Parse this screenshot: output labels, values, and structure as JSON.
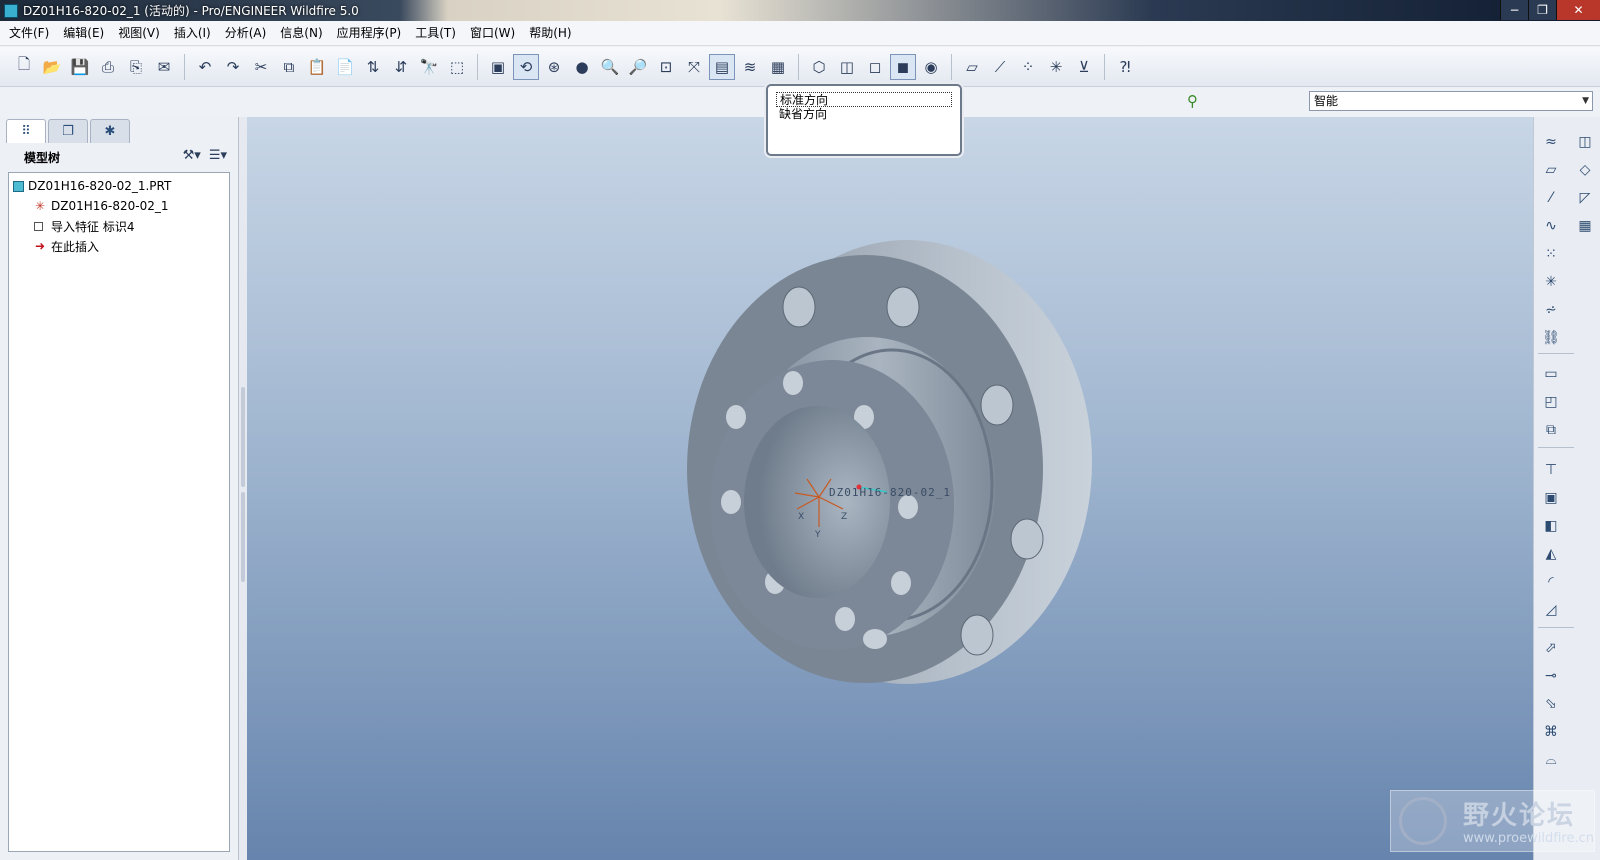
{
  "window": {
    "title": "DZ01H16-820-02_1 (活动的) - Pro/ENGINEER Wildfire 5.0",
    "buttons": [
      "−",
      "❐",
      "✕"
    ]
  },
  "menu": [
    "文件(F)",
    "编辑(E)",
    "视图(V)",
    "插入(I)",
    "分析(A)",
    "信息(N)",
    "应用程序(P)",
    "工具(T)",
    "窗口(W)",
    "帮助(H)"
  ],
  "toolbar": {
    "groups": [
      [
        "new-icon",
        "open-icon",
        "save-icon",
        "print-icon",
        "print-preview-icon",
        "email-icon"
      ],
      [
        "undo-icon",
        "redo-icon",
        "cut-icon",
        "copy-icon",
        "paste-icon",
        "paste-special-icon",
        "regenerate-icon",
        "regenerate-manager-icon",
        "find-icon",
        "select-box-icon"
      ],
      [
        "redraw-icon",
        "spin-center-icon",
        "orient-mode-icon",
        "appearance-icon",
        "zoom-in-icon",
        "zoom-out-icon",
        "refit-icon",
        "reorient-icon",
        "saved-views-icon",
        "layers-icon",
        "view-manager-icon"
      ],
      [
        "wireframe-icon",
        "hidden-line-icon",
        "no-hidden-icon",
        "shading-icon",
        "enhanced-realism-icon"
      ],
      [
        "datum-planes-icon",
        "datum-axes-icon",
        "datum-points-icon",
        "coord-systems-icon",
        "annotations-icon"
      ],
      [
        "context-help-icon"
      ]
    ],
    "pressed": [
      "orient-mode-icon",
      "saved-views-icon",
      "shading-icon"
    ]
  },
  "view_dropdown": {
    "options": [
      "标准方向",
      "缺省方向"
    ],
    "selected": "标准方向"
  },
  "filter": {
    "value": "智能"
  },
  "left_panel": {
    "tabs": [
      "model-tree-tab-icon",
      "folder-browser-tab-icon",
      "favorites-tab-icon"
    ],
    "header": "模型树",
    "tree": [
      {
        "label": "DZ01H16-820-02_1.PRT",
        "icon": "part-icon",
        "level": 0
      },
      {
        "label": "DZ01H16-820-02_1",
        "icon": "csys-icon",
        "level": 1
      },
      {
        "label": "导入特征 标识4",
        "icon": "import-feature-icon",
        "level": 1
      },
      {
        "label": "在此插入",
        "icon": "insert-here-icon",
        "level": 1
      }
    ]
  },
  "viewport": {
    "csys_label": "DZ01H16-820-02_1",
    "axis_labels": [
      "X",
      "Y",
      "Z"
    ]
  },
  "watermark": {
    "title": "野火论坛",
    "url": "www.proewildfire.cn"
  },
  "colors": {
    "viewport_top": "#c8d6e6",
    "viewport_bottom": "#6684ad",
    "part_face": "#7a8694",
    "part_light": "#b8c2cc"
  }
}
